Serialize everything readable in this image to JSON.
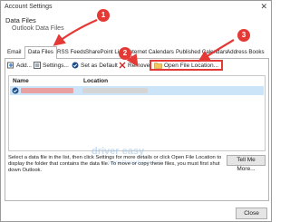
{
  "window": {
    "title": "Account Settings",
    "close": "✕"
  },
  "header": {
    "title": "Data Files",
    "subtitle": "Outlook Data Files"
  },
  "tabs": [
    {
      "label": "Email",
      "active": false
    },
    {
      "label": "Data Files",
      "active": true
    },
    {
      "label": "RSS Feeds",
      "active": false
    },
    {
      "label": "SharePoint Lists",
      "active": false
    },
    {
      "label": "Internet Calendars",
      "active": false
    },
    {
      "label": "Published Calendars",
      "active": false
    },
    {
      "label": "Address Books",
      "active": false
    }
  ],
  "toolbar": {
    "add": "Add...",
    "settings": "Settings...",
    "set_default": "Set as Default",
    "remove": "Remove",
    "open_location": "Open File Location..."
  },
  "list": {
    "col_name": "Name",
    "col_location": "Location"
  },
  "watermark": {
    "brand": "driver easy",
    "url": "www.DriverEasy.com"
  },
  "description": "Select a data file in the list, then click Settings for more details or click Open File Location to display the folder that contains the data file. To move or copy these files, you must first shut down Outlook.",
  "buttons": {
    "tell_me_more": "Tell Me More...",
    "close": "Close"
  },
  "annotations": [
    "1",
    "2",
    "3"
  ],
  "colors": {
    "annotation": "#e53935",
    "selected_row": "#cce4f7",
    "accent": "#2b78c5"
  }
}
